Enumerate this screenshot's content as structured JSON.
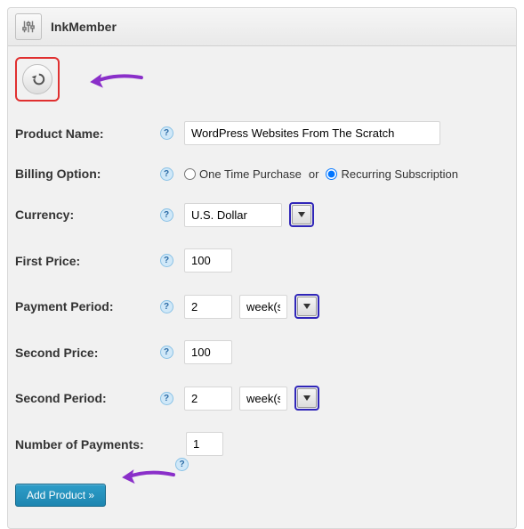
{
  "header": {
    "title": "InkMember"
  },
  "form": {
    "product_name": {
      "label": "Product Name:",
      "value": "WordPress Websites From The Scratch"
    },
    "billing_option": {
      "label": "Billing Option:",
      "one_time_label": "One Time Purchase",
      "or_text": "or",
      "recurring_label": "Recurring Subscription"
    },
    "currency": {
      "label": "Currency:",
      "value": "U.S. Dollar"
    },
    "first_price": {
      "label": "First Price:",
      "value": "100"
    },
    "payment_period": {
      "label": "Payment Period:",
      "value": "2",
      "unit": "week(s)"
    },
    "second_price": {
      "label": "Second Price:",
      "value": "100"
    },
    "second_period": {
      "label": "Second Period:",
      "value": "2",
      "unit": "week(s)"
    },
    "number_of_payments": {
      "label": "Number of Payments:",
      "value": "1"
    }
  },
  "buttons": {
    "add_product": "Add Product »"
  },
  "colors": {
    "highlight_red": "#e03030",
    "highlight_blue": "#3026b8",
    "arrow_purple": "#8a2fc9",
    "primary_btn": "#1d86b1"
  }
}
